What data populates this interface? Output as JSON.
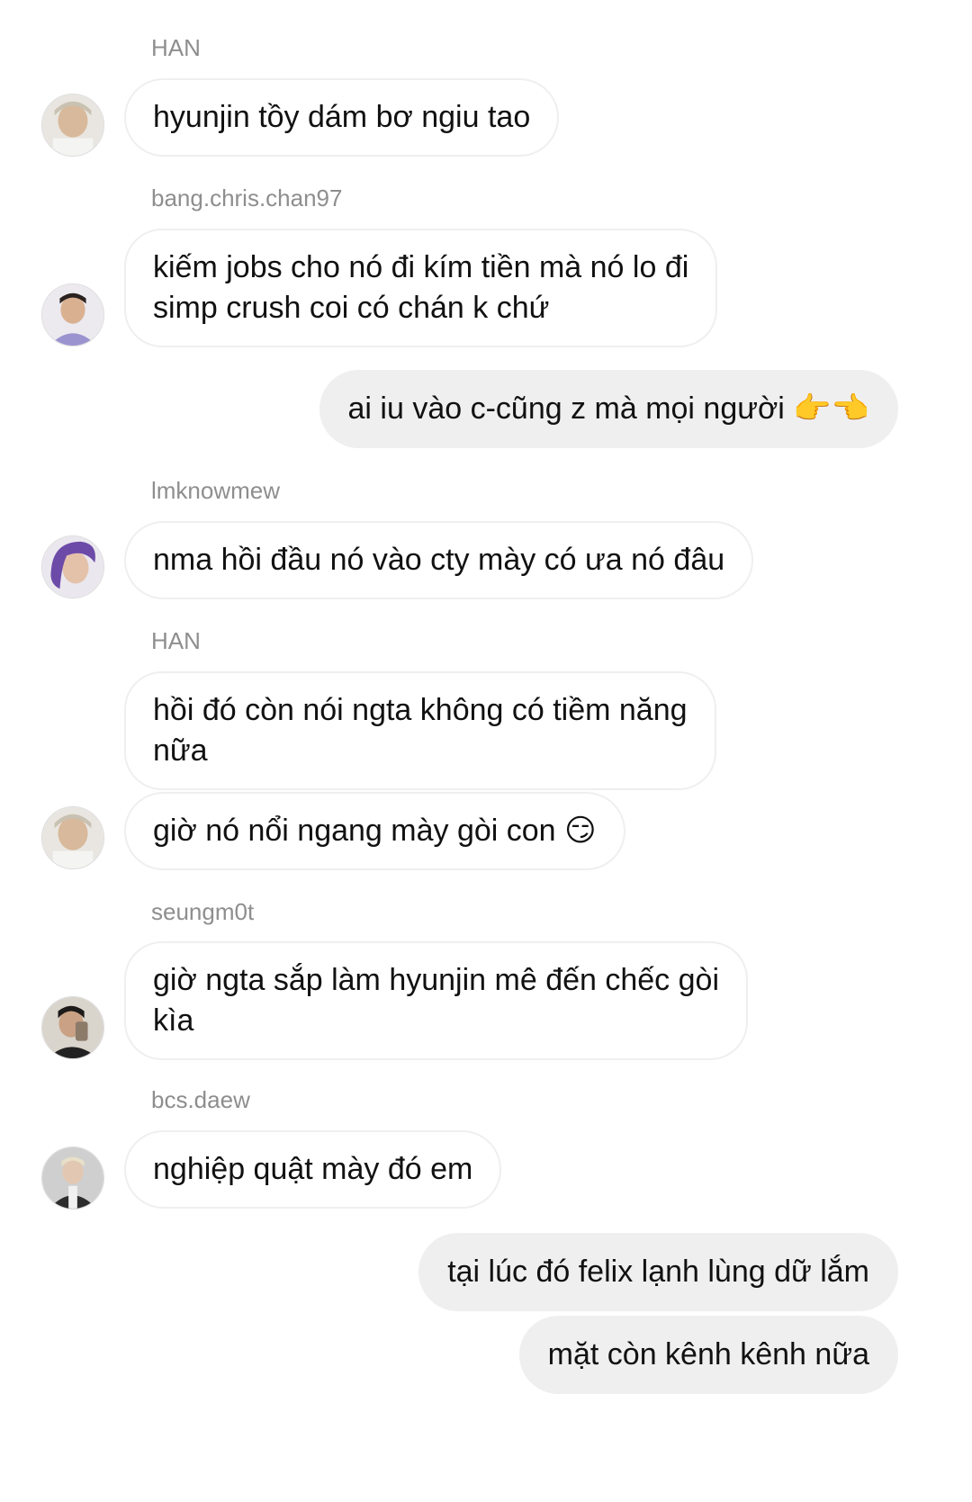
{
  "messages": [
    {
      "sender": "HAN",
      "text": "hyunjin tồy dám bơ ngiu tao"
    },
    {
      "sender": "bang.chris.chan97",
      "line1": "kiếm jobs cho nó đi kím tiền mà nó lo đi",
      "line2": "simp crush coi có chán k chứ"
    },
    {
      "text": "ai iu vào c-cũng z mà mọi người",
      "emoji": "👉👈"
    },
    {
      "sender": "lmknowmew",
      "text": "nma hồi đầu nó vào cty mày có ưa nó đâu"
    },
    {
      "sender": "HAN",
      "line1": "hồi đó còn nói ngta không có tiềm năng",
      "line2": "nữa"
    },
    {
      "text": "giờ nó nổi ngang mày gòi con",
      "emoji": "😏"
    },
    {
      "sender": "seungm0t",
      "line1": "giờ ngta sắp làm hyunjin mê đến chếc gòi",
      "line2": "kìa"
    },
    {
      "sender": "bcs.daew",
      "text": "nghiệp quật mày đó em"
    },
    {
      "text": "tại lúc đó felix lạnh lùng dữ lắm"
    },
    {
      "text": "mặt còn kênh kênh nữa"
    }
  ]
}
